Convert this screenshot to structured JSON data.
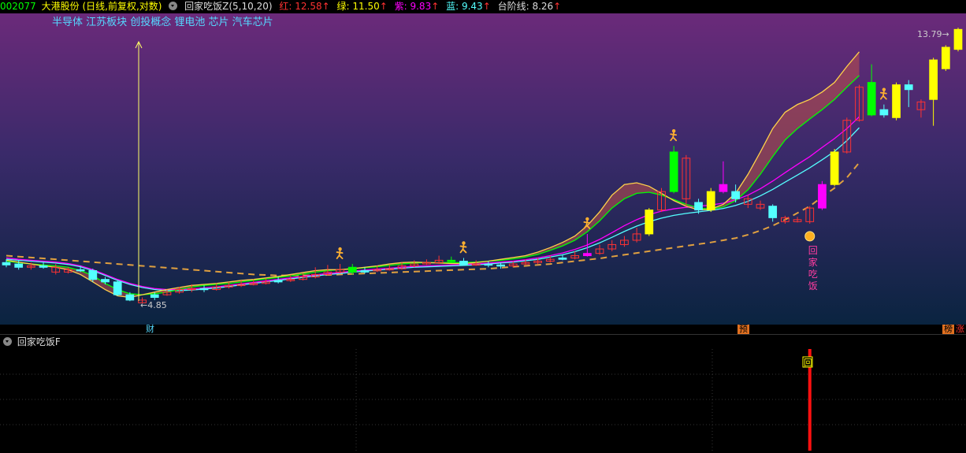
{
  "header": {
    "code": "002077",
    "name": "大港股份",
    "mode": "(日线,前复权,对数)",
    "indicator": "回家吃饭Z(5,10,20)",
    "red_label": "红:",
    "red_value": "12.58",
    "green_label": "绿:",
    "green_value": "11.50",
    "purple_label": "紫:",
    "purple_value": "9.83",
    "blue_label": "蓝:",
    "blue_value": "9.43",
    "step_label": "台阶线:",
    "step_value": "8.26",
    "up_arrow": "↑"
  },
  "concepts": "半导体 江苏板块 创投概念 锂电池 芯片 汽车芯片",
  "annotations": {
    "high_label": "13.79",
    "low_label": "4.85",
    "signal_text": [
      "回",
      "家",
      "吃",
      "饭"
    ]
  },
  "date_strip": {
    "tag_cai": "财",
    "tag_yu": "预",
    "tag_bang": "榜",
    "tag_zhang": "涨"
  },
  "sub_panel": {
    "title": "回家吃饭F",
    "marker": "回"
  },
  "colors": {
    "red": "#ff3232",
    "green": "#00ff00",
    "purple": "#ff00ff",
    "cyan": "#54ffff",
    "yellow": "#ffff00",
    "step": "#e0a040",
    "bg_top": "#6b2a7a",
    "bg_bottom": "#0a2440"
  },
  "chart_data": {
    "type": "candlestick",
    "scale": "log",
    "y_visible_min": 4.85,
    "y_visible_max": 13.79,
    "candles": [
      [
        5.65,
        5.6,
        5.72,
        5.55,
        "cyan"
      ],
      [
        5.62,
        5.55,
        5.7,
        5.5,
        "cyan"
      ],
      [
        5.55,
        5.58,
        5.65,
        5.5,
        "red"
      ],
      [
        5.58,
        5.55,
        5.65,
        5.52,
        "cyan"
      ],
      [
        5.55,
        5.45,
        5.62,
        5.4,
        "red"
      ],
      [
        5.45,
        5.5,
        5.55,
        5.42,
        "red"
      ],
      [
        5.5,
        5.48,
        5.58,
        5.45,
        "cyan"
      ],
      [
        5.48,
        5.3,
        5.52,
        5.25,
        "cyan"
      ],
      [
        5.3,
        5.25,
        5.35,
        5.2,
        "cyan"
      ],
      [
        5.25,
        5.0,
        5.28,
        4.98,
        "cyan"
      ],
      [
        5.0,
        4.9,
        5.05,
        4.88,
        "cyan"
      ],
      [
        4.9,
        4.85,
        4.95,
        4.85,
        "red"
      ],
      [
        4.95,
        5.0,
        5.05,
        4.9,
        "cyan"
      ],
      [
        5.0,
        5.05,
        5.1,
        4.98,
        "red"
      ],
      [
        5.05,
        5.1,
        5.15,
        5.02,
        "red"
      ],
      [
        5.1,
        5.12,
        5.2,
        5.05,
        "red"
      ],
      [
        5.12,
        5.1,
        5.18,
        5.05,
        "cyan"
      ],
      [
        5.1,
        5.15,
        5.22,
        5.08,
        "red"
      ],
      [
        5.15,
        5.18,
        5.25,
        5.12,
        "red"
      ],
      [
        5.18,
        5.2,
        5.28,
        5.15,
        "red"
      ],
      [
        5.2,
        5.22,
        5.3,
        5.18,
        "red"
      ],
      [
        5.22,
        5.25,
        5.32,
        5.2,
        "red"
      ],
      [
        5.25,
        5.28,
        5.35,
        5.22,
        "cyan"
      ],
      [
        5.28,
        5.3,
        5.38,
        5.25,
        "red"
      ],
      [
        5.3,
        5.35,
        5.42,
        5.28,
        "red"
      ],
      [
        5.35,
        5.4,
        5.55,
        5.32,
        "red"
      ],
      [
        5.4,
        5.45,
        5.6,
        5.38,
        "red"
      ],
      [
        5.45,
        5.5,
        5.62,
        5.42,
        "red"
      ],
      [
        5.55,
        5.45,
        5.62,
        5.4,
        "green"
      ],
      [
        5.45,
        5.48,
        5.55,
        5.42,
        "cyan"
      ],
      [
        5.48,
        5.5,
        5.58,
        5.45,
        "red"
      ],
      [
        5.5,
        5.52,
        5.6,
        5.48,
        "red"
      ],
      [
        5.52,
        5.58,
        5.65,
        5.5,
        "red"
      ],
      [
        5.58,
        5.62,
        5.7,
        5.55,
        "red"
      ],
      [
        5.62,
        5.65,
        5.72,
        5.6,
        "red"
      ],
      [
        5.65,
        5.7,
        5.8,
        5.62,
        "red"
      ],
      [
        5.7,
        5.68,
        5.78,
        5.65,
        "green"
      ],
      [
        5.68,
        5.6,
        5.75,
        5.58,
        "cyan"
      ],
      [
        5.6,
        5.62,
        5.7,
        5.58,
        "red"
      ],
      [
        5.62,
        5.6,
        5.68,
        5.55,
        "cyan"
      ],
      [
        5.6,
        5.58,
        5.65,
        5.52,
        "cyan"
      ],
      [
        5.58,
        5.62,
        5.68,
        5.55,
        "red"
      ],
      [
        5.62,
        5.65,
        5.72,
        5.6,
        "red"
      ],
      [
        5.65,
        5.68,
        5.75,
        5.62,
        "red"
      ],
      [
        5.68,
        5.72,
        5.8,
        5.65,
        "red"
      ],
      [
        5.72,
        5.75,
        5.82,
        5.7,
        "cyan"
      ],
      [
        5.75,
        5.8,
        5.9,
        5.72,
        "red"
      ],
      [
        5.8,
        5.85,
        6.3,
        5.78,
        "purple"
      ],
      [
        5.85,
        5.95,
        6.05,
        5.82,
        "red"
      ],
      [
        5.95,
        6.05,
        6.15,
        5.9,
        "red"
      ],
      [
        6.05,
        6.15,
        6.25,
        6.0,
        "red"
      ],
      [
        6.15,
        6.3,
        6.45,
        6.1,
        "red"
      ],
      [
        6.3,
        6.9,
        6.95,
        6.25,
        "yellow"
      ],
      [
        6.9,
        7.4,
        7.5,
        6.85,
        "red"
      ],
      [
        7.4,
        8.6,
        8.8,
        7.35,
        "green"
      ],
      [
        8.4,
        7.2,
        8.5,
        7.0,
        "red"
      ],
      [
        7.1,
        6.9,
        7.2,
        6.8,
        "cyan"
      ],
      [
        6.9,
        7.4,
        7.5,
        6.85,
        "yellow"
      ],
      [
        7.4,
        7.6,
        8.3,
        7.35,
        "purple"
      ],
      [
        7.4,
        7.2,
        7.6,
        7.1,
        "cyan"
      ],
      [
        7.2,
        7.05,
        7.3,
        6.95,
        "red"
      ],
      [
        7.05,
        6.95,
        7.15,
        6.9,
        "red"
      ],
      [
        7.0,
        6.7,
        7.05,
        6.6,
        "cyan"
      ],
      [
        6.7,
        6.6,
        6.75,
        6.55,
        "red"
      ],
      [
        6.65,
        6.6,
        6.72,
        6.58,
        "red"
      ],
      [
        6.6,
        6.95,
        7.0,
        6.55,
        "red"
      ],
      [
        6.95,
        7.6,
        7.7,
        6.9,
        "purple"
      ],
      [
        7.6,
        8.6,
        8.7,
        7.55,
        "yellow"
      ],
      [
        8.6,
        9.7,
        9.8,
        8.55,
        "red"
      ],
      [
        9.7,
        11.0,
        11.1,
        9.65,
        "red"
      ],
      [
        9.9,
        11.2,
        12.0,
        9.85,
        "green"
      ],
      [
        10.1,
        9.9,
        10.3,
        9.8,
        "cyan"
      ],
      [
        9.8,
        11.1,
        11.2,
        9.7,
        "yellow"
      ],
      [
        10.9,
        11.1,
        11.3,
        10.2,
        "cyan"
      ],
      [
        10.4,
        10.1,
        10.5,
        9.8,
        "red"
      ],
      [
        10.5,
        12.2,
        12.3,
        9.5,
        "yellow"
      ],
      [
        11.8,
        12.8,
        12.9,
        11.7,
        "yellow"
      ],
      [
        12.7,
        13.7,
        13.79,
        12.6,
        "yellow"
      ]
    ],
    "ma_red": [
      5.7,
      5.66,
      5.62,
      5.58,
      5.55,
      5.5,
      5.4,
      5.25,
      5.1,
      4.98,
      4.95,
      5.0,
      5.05,
      5.1,
      5.14,
      5.18,
      5.2,
      5.22,
      5.25,
      5.28,
      5.3,
      5.33,
      5.36,
      5.4,
      5.44,
      5.48,
      5.5,
      5.5,
      5.52,
      5.55,
      5.58,
      5.62,
      5.65,
      5.66,
      5.65,
      5.64,
      5.63,
      5.63,
      5.65,
      5.68,
      5.72,
      5.76,
      5.8,
      5.88,
      5.98,
      6.1,
      6.25,
      6.5,
      6.85,
      7.3,
      7.6,
      7.65,
      7.55,
      7.35,
      7.15,
      7.0,
      6.9,
      6.92,
      7.05,
      7.35,
      7.9,
      8.6,
      9.4,
      10.0,
      10.3,
      10.5,
      10.8,
      11.2,
      11.9,
      12.58
    ],
    "ma_green": [
      5.68,
      5.65,
      5.62,
      5.6,
      5.58,
      5.55,
      5.48,
      5.38,
      5.22,
      5.1,
      5.02,
      5.0,
      5.02,
      5.05,
      5.1,
      5.15,
      5.18,
      5.2,
      5.22,
      5.25,
      5.28,
      5.31,
      5.34,
      5.37,
      5.41,
      5.45,
      5.48,
      5.5,
      5.52,
      5.54,
      5.56,
      5.59,
      5.62,
      5.64,
      5.65,
      5.65,
      5.65,
      5.65,
      5.66,
      5.68,
      5.7,
      5.73,
      5.77,
      5.83,
      5.92,
      6.02,
      6.15,
      6.35,
      6.62,
      6.95,
      7.2,
      7.35,
      7.38,
      7.3,
      7.18,
      7.05,
      6.95,
      6.92,
      6.98,
      7.15,
      7.45,
      7.9,
      8.45,
      9.0,
      9.4,
      9.75,
      10.1,
      10.5,
      11.0,
      11.5
    ],
    "ma_purple": [
      5.75,
      5.72,
      5.7,
      5.68,
      5.66,
      5.63,
      5.58,
      5.5,
      5.4,
      5.3,
      5.22,
      5.16,
      5.12,
      5.1,
      5.1,
      5.11,
      5.13,
      5.15,
      5.18,
      5.21,
      5.24,
      5.27,
      5.3,
      5.33,
      5.36,
      5.39,
      5.42,
      5.44,
      5.47,
      5.49,
      5.51,
      5.53,
      5.55,
      5.57,
      5.58,
      5.59,
      5.6,
      5.61,
      5.62,
      5.64,
      5.66,
      5.68,
      5.71,
      5.75,
      5.8,
      5.86,
      5.94,
      6.04,
      6.17,
      6.33,
      6.5,
      6.65,
      6.78,
      6.87,
      6.93,
      6.97,
      7.0,
      7.03,
      7.08,
      7.17,
      7.3,
      7.48,
      7.7,
      7.95,
      8.2,
      8.45,
      8.75,
      9.05,
      9.4,
      9.83
    ],
    "ma_blue": [
      5.72,
      5.7,
      5.68,
      5.66,
      5.64,
      5.61,
      5.56,
      5.48,
      5.38,
      5.28,
      5.2,
      5.14,
      5.1,
      5.08,
      5.08,
      5.09,
      5.11,
      5.13,
      5.16,
      5.19,
      5.22,
      5.25,
      5.28,
      5.31,
      5.34,
      5.37,
      5.4,
      5.42,
      5.45,
      5.47,
      5.49,
      5.51,
      5.53,
      5.55,
      5.56,
      5.57,
      5.58,
      5.59,
      5.6,
      5.62,
      5.64,
      5.66,
      5.69,
      5.72,
      5.77,
      5.82,
      5.89,
      5.98,
      6.09,
      6.22,
      6.36,
      6.49,
      6.6,
      6.69,
      6.76,
      6.81,
      6.85,
      6.89,
      6.94,
      7.02,
      7.13,
      7.28,
      7.46,
      7.67,
      7.88,
      8.1,
      8.35,
      8.62,
      8.98,
      9.43
    ],
    "step_line": [
      5.8,
      5.78,
      5.76,
      5.74,
      5.72,
      5.7,
      5.68,
      5.66,
      5.64,
      5.62,
      5.6,
      5.58,
      5.56,
      5.54,
      5.52,
      5.5,
      5.48,
      5.46,
      5.44,
      5.42,
      5.4,
      5.39,
      5.38,
      5.38,
      5.38,
      5.38,
      5.39,
      5.4,
      5.41,
      5.42,
      5.43,
      5.44,
      5.45,
      5.46,
      5.47,
      5.48,
      5.49,
      5.5,
      5.51,
      5.52,
      5.54,
      5.56,
      5.58,
      5.6,
      5.62,
      5.65,
      5.68,
      5.71,
      5.74,
      5.78,
      5.82,
      5.86,
      5.9,
      5.94,
      5.98,
      6.02,
      6.06,
      6.1,
      6.15,
      6.2,
      6.28,
      6.38,
      6.5,
      6.65,
      6.82,
      7.0,
      7.25,
      7.5,
      7.8,
      8.26
    ],
    "runner_icons_at": [
      27,
      37,
      47,
      54,
      71
    ],
    "signal_bar_at": 65
  }
}
